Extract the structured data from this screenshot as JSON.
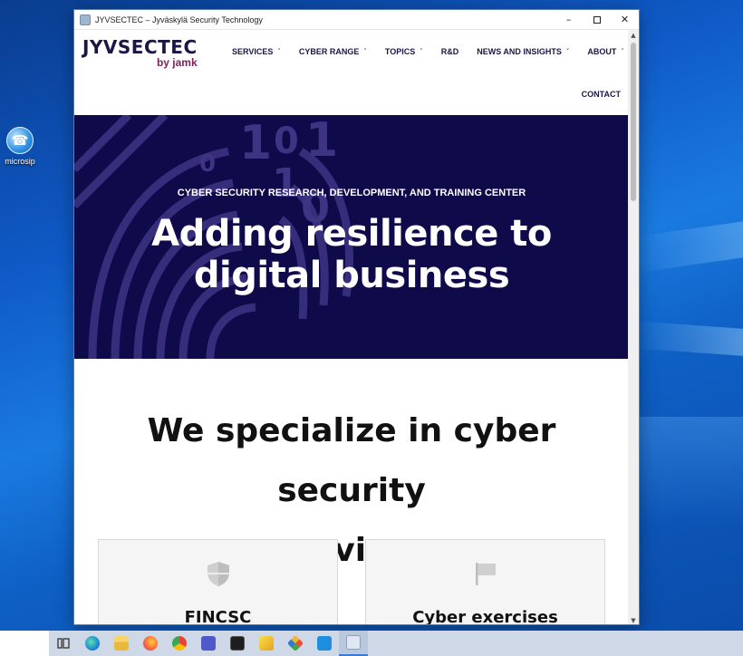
{
  "desktop": {
    "icon_label": "microsip"
  },
  "window": {
    "title": "JYVSECTEC – Jyväskylä Security Technology",
    "controls": {
      "minimize": "–",
      "maximize": "",
      "close": "✕"
    }
  },
  "site": {
    "logo_main": "JYVSECTEC",
    "logo_sub": "by jamk",
    "nav": [
      {
        "label": "SERVICES",
        "has_dropdown": true
      },
      {
        "label": "CYBER RANGE",
        "has_dropdown": true
      },
      {
        "label": "TOPICS",
        "has_dropdown": true
      },
      {
        "label": "R&D",
        "has_dropdown": false
      },
      {
        "label": "NEWS AND INSIGHTS",
        "has_dropdown": true
      },
      {
        "label": "ABOUT",
        "has_dropdown": true
      }
    ],
    "contact": "CONTACT",
    "hero": {
      "eyebrow": "CYBER SECURITY RESEARCH, DEVELOPMENT, AND TRAINING CENTER",
      "headline_line1": "Adding resilience to",
      "headline_line2": "digital business",
      "background_digits": [
        "1",
        "0",
        "1",
        "0",
        "1",
        "0"
      ]
    },
    "specialize": {
      "heading_line1": "We specialize in cyber security",
      "heading_line2": "services",
      "cards": [
        {
          "title": "FINCSC",
          "icon": "shield-icon"
        },
        {
          "title": "Cyber exercises",
          "icon": "flag-icon"
        }
      ]
    }
  },
  "taskbar": {
    "items": [
      "task-view-icon",
      "edge-icon",
      "file-explorer-icon",
      "firefox-icon",
      "chrome-icon",
      "teams-icon",
      "terminal-icon",
      "app-icon",
      "git-icon",
      "vscode-icon",
      "microsip-icon"
    ]
  },
  "colors": {
    "hero_bg": "#0f0a4a",
    "brand_navy": "#1a1747",
    "brand_plum": "#7b1f5d",
    "fingerprint": "#4a3f8f"
  }
}
